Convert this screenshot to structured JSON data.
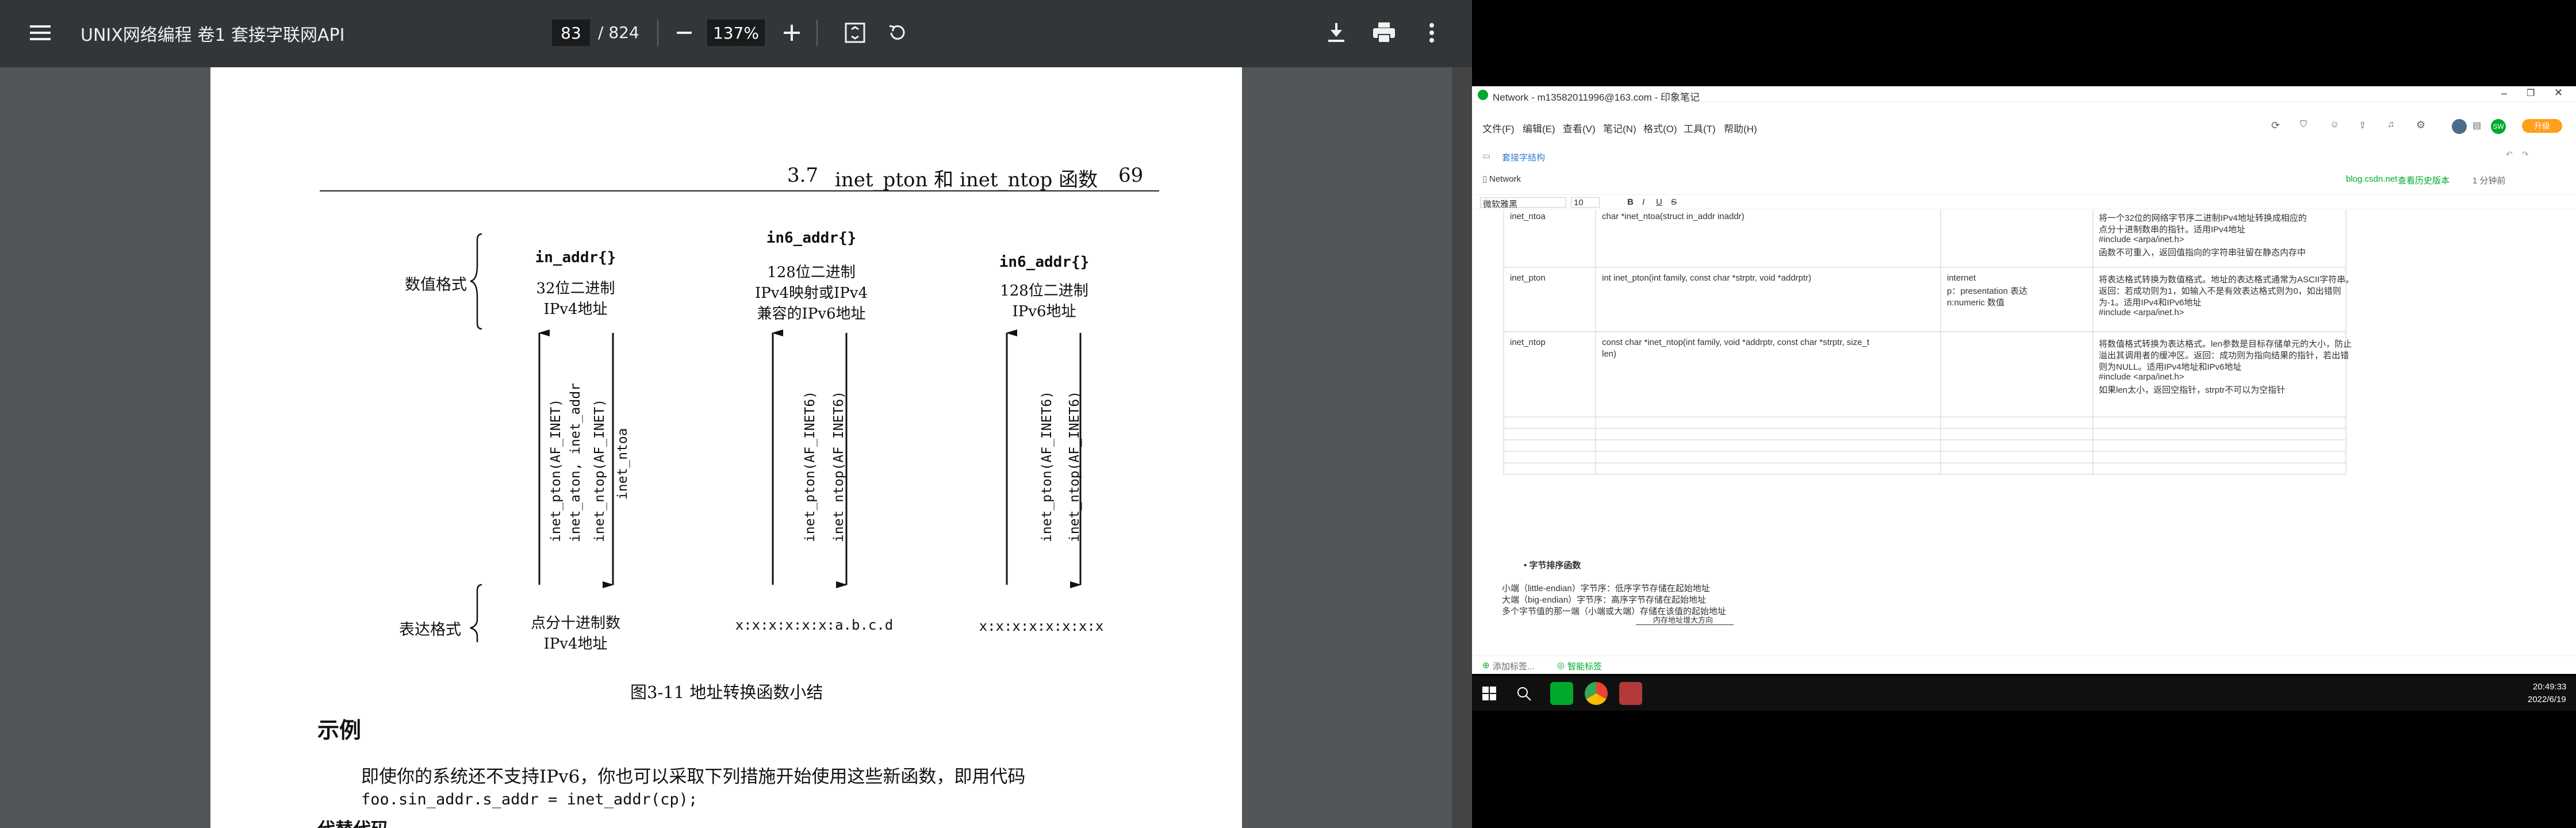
{
  "pdf_viewer": {
    "title": "UNIX网络编程 卷1 套接字联网API",
    "current_page": "83",
    "total_pages": "/ 824",
    "zoom": "137%",
    "icons": [
      "menu-icon",
      "zoom-out-icon",
      "zoom-in-icon",
      "fit-page-icon",
      "rotate-icon",
      "download-icon",
      "print-icon",
      "more-icon"
    ]
  },
  "page": {
    "header_section": "3.7",
    "header_title": "inet_pton 和 inet_ntop 函数",
    "header_page": "69",
    "row_label_top": "数值格式",
    "row_label_bottom": "表达格式",
    "col1_struct": "in_addr{}",
    "col1_l1": "32位二进制",
    "col1_l2": "IPv4地址",
    "col2_struct": "in6_addr{}",
    "col2_l1": "128位二进制",
    "col2_l2": "IPv4映射或IPv4",
    "col2_l3": "兼容的IPv6地址",
    "col3_struct": "in6_addr{}",
    "col3_l1": "128位二进制",
    "col3_l2": "IPv6地址",
    "col1_up_fn1": "inet_pton(AF_INET)",
    "col1_up_fn2": "inet_aton, inet_addr",
    "col1_down_fn1": "inet_ntop(AF_INET)",
    "col1_down_fn2": "inet_ntoa",
    "col2_up_fn": "inet_pton(AF_INET6)",
    "col2_down_fn": "inet_ntop(AF_INET6)",
    "col3_up_fn": "inet_pton(AF_INET6)",
    "col3_down_fn": "inet_ntop(AF_INET6)",
    "col1_bottom_l1": "点分十进制数",
    "col1_bottom_l2": "IPv4地址",
    "col2_bottom": "x:x:x:x:x:x:a.b.c.d",
    "col3_bottom": "x:x:x:x:x:x:x:x",
    "figure_caption": "图3-11   地址转换函数小结",
    "section_title": "示例",
    "body_text": "即使你的系统还不支持IPv6，你也可以采取下列措施开始使用这些新函数，即用代码",
    "code_line": "foo.sin_addr.s_addr = inet_addr(cp);",
    "cut_line": "代替代码"
  },
  "note_app": {
    "window_title": "Network - m13582011996@163.com - 印象笔记",
    "menu": [
      "文件(F)",
      "编辑(E)",
      "查看(V)",
      "笔记(N)",
      "格式(O)",
      "工具(T)",
      "帮助(H)"
    ],
    "upgrade_label": "升级",
    "avatar_initials": "SW",
    "breadcrumb": "套接字结构",
    "notebook": "Network",
    "source_link": "blog.csdn.net",
    "history_button": "查看历史版本",
    "reading_time": "1 分钟前",
    "font_name": "微软雅黑",
    "font_size": "10",
    "table_rows": [
      {
        "name": "inet_ntoa",
        "proto": "char *inet_ntoa(struct in_addr inaddr)",
        "extra": "",
        "desc": [
          "将一个32位的网络字节序二进制IPv4地址转换成相应的",
          "点分十进制数串的指针。适用IPv4地址",
          "#include <arpa/inet.h>",
          "函数不可重入，返回值指向的字符串驻留在静态内存中"
        ]
      },
      {
        "name": "inet_pton",
        "proto": "int inet_pton(int family, const char *strptr, void *addrptr)",
        "extra": [
          "internet",
          "p：presentation 表达",
          "n:numeric 数值"
        ],
        "desc": [
          "将表达格式转换为数值格式。地址的表达格式通常为ASCII字符串。",
          "返回：若成功则为1，如输入不是有效表达格式则为0，如出错则",
          "为-1。适用IPv4和IPv6地址",
          "#include <arpa/inet.h>"
        ]
      },
      {
        "name": "inet_ntop",
        "proto": [
          "const char *inet_ntop(int family, void *addrptr, const char *strptr, size_t",
          "len)"
        ],
        "extra": "",
        "desc": [
          "将数值格式转换为表达格式。len参数是目标存储单元的大小，防止",
          "溢出其调用者的缓冲区。返回：成功则为指向结果的指针，若出错",
          "则为NULL。适用IPv4地址和IPv6地址",
          "#include <arpa/inet.h>",
          "如果len太小，返回空指针，strptr不可以为空指针"
        ]
      }
    ],
    "bullet_heading": "字节排序函数",
    "byte_lines": [
      "小端（little-endian）字节序：低序字节存储在起始地址",
      "大端（big-endian）字节序：高序字节存储在起始地址",
      "多个字节值的那一端（小端或大端）存储在该值的起始地址"
    ],
    "arrow_label": "内存地址增大方向",
    "tag_add": "添加标签...",
    "tag_smart": "智能标签"
  },
  "taskbar": {
    "time": "20:49:33",
    "date": "2022/6/19"
  }
}
